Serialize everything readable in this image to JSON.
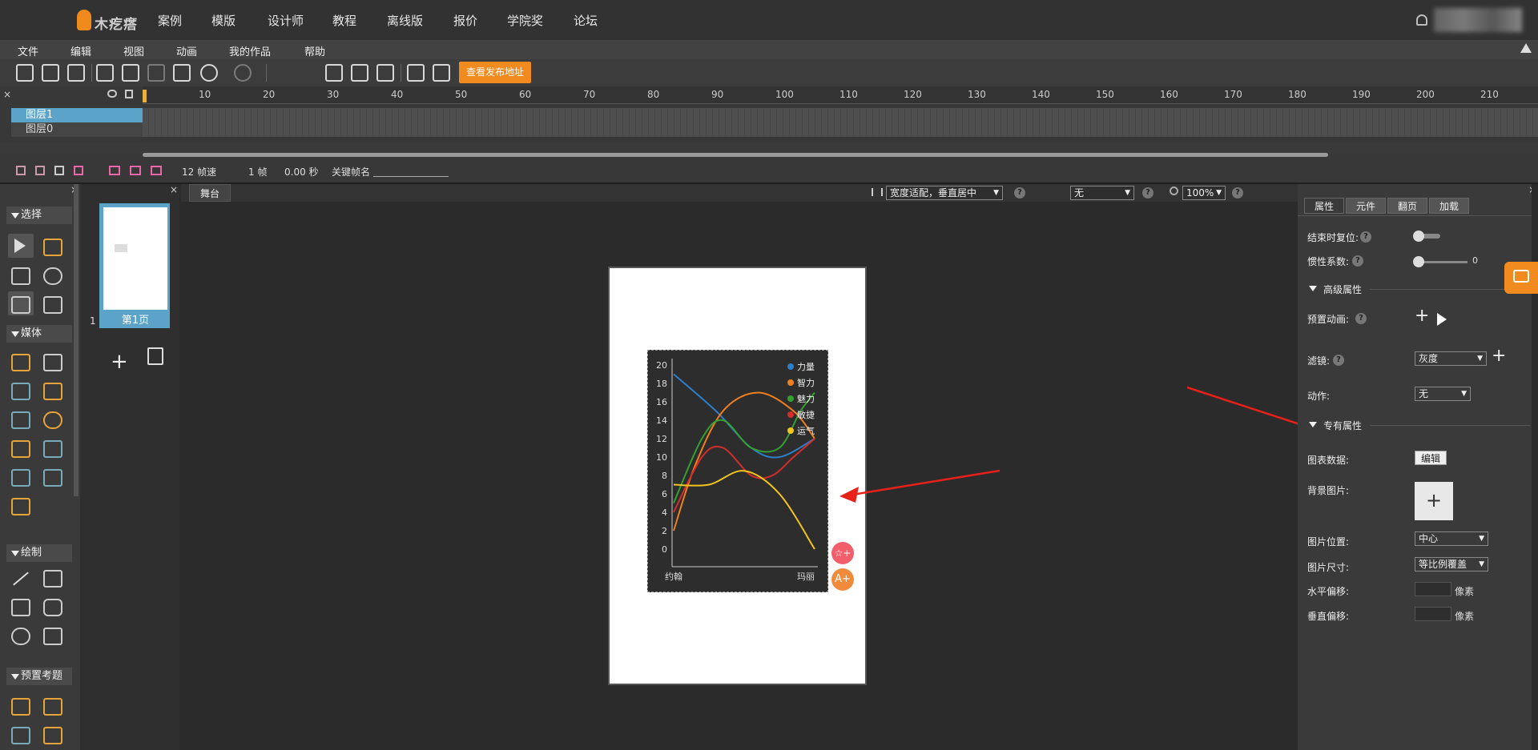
{
  "topnav": {
    "logo_text": "木疙瘩",
    "items": [
      "案例",
      "模版",
      "设计师",
      "教程",
      "离线版",
      "报价",
      "学院奖",
      "论坛"
    ]
  },
  "menubar": {
    "items": [
      "文件",
      "编辑",
      "视图",
      "动画",
      "我的作品",
      "帮助"
    ]
  },
  "toolbar": {
    "publish_label": "查看发布地址"
  },
  "timeline": {
    "ticks": [
      "10",
      "20",
      "30",
      "40",
      "50",
      "60",
      "70",
      "80",
      "90",
      "100",
      "110",
      "120",
      "130",
      "140",
      "150",
      "160",
      "170",
      "180",
      "190",
      "200",
      "210"
    ],
    "layers": [
      "图层1",
      "图层0"
    ],
    "fps": "12 帧速",
    "frame": "1 帧",
    "time": "0.00 秒",
    "keyframe_label": "关键帧名"
  },
  "leftpanel": {
    "sections": [
      "选择",
      "媒体",
      "绘制",
      "预置考题"
    ]
  },
  "pages": {
    "number": "1",
    "label": "第1页"
  },
  "stage": {
    "tab": "舞台",
    "fit_mode": "宽度适配，垂直居中",
    "bg_select": "无",
    "zoom": "100%"
  },
  "canvas": {
    "fab1": "☆+",
    "fab2": "A+"
  },
  "rightpanel": {
    "tabs": [
      "属性",
      "元件",
      "翻页",
      "加载"
    ],
    "reset_label": "结束时复位:",
    "inertia_label": "惯性系数:",
    "inertia_value": "0",
    "advanced_section": "高级属性",
    "preset_anim_label": "预置动画:",
    "filter_label": "滤镜:",
    "filter_value": "灰度",
    "action_label": "动作:",
    "action_value": "无",
    "private_section": "专有属性",
    "chart_data_label": "图表数据:",
    "edit_button": "编辑",
    "bg_image_label": "背景图片:",
    "img_pos_label": "图片位置:",
    "img_pos_value": "中心",
    "img_size_label": "图片尺寸:",
    "img_size_value": "等比例覆盖",
    "h_offset_label": "水平偏移:",
    "v_offset_label": "垂直偏移:",
    "px_unit": "像素"
  },
  "colors": {
    "accent": "#f18b1f",
    "arrow": "#e8201a",
    "thumb_blue": "#5ba3c9"
  },
  "chart_data": {
    "type": "line",
    "categories": [
      "约翰",
      "玛丽"
    ],
    "ylim": [
      0,
      20
    ],
    "yticks": [
      "0",
      "2",
      "4",
      "6",
      "8",
      "10",
      "12",
      "14",
      "16",
      "18",
      "20"
    ],
    "legend_position": "top-right",
    "series": [
      {
        "name": "力量",
        "color": "#2e7fc9",
        "points": [
          [
            0,
            19
          ],
          [
            0.3,
            15
          ],
          [
            0.55,
            11
          ],
          [
            0.75,
            10
          ],
          [
            1,
            12
          ]
        ]
      },
      {
        "name": "智力",
        "color": "#f07f1f",
        "points": [
          [
            0,
            2
          ],
          [
            0.15,
            9
          ],
          [
            0.35,
            15
          ],
          [
            0.6,
            17
          ],
          [
            0.85,
            15
          ],
          [
            1,
            12
          ]
        ]
      },
      {
        "name": "魅力",
        "color": "#35a032",
        "points": [
          [
            0,
            5
          ],
          [
            0.2,
            12
          ],
          [
            0.35,
            14
          ],
          [
            0.55,
            11
          ],
          [
            0.75,
            11
          ],
          [
            0.9,
            15
          ],
          [
            1,
            17
          ]
        ]
      },
      {
        "name": "敏捷",
        "color": "#d42d2d",
        "points": [
          [
            0,
            4
          ],
          [
            0.2,
            10
          ],
          [
            0.35,
            11
          ],
          [
            0.55,
            8
          ],
          [
            0.7,
            8
          ],
          [
            0.85,
            10
          ],
          [
            1,
            12
          ]
        ]
      },
      {
        "name": "运气",
        "color": "#f2c51d",
        "points": [
          [
            0,
            7
          ],
          [
            0.25,
            7
          ],
          [
            0.5,
            8.5
          ],
          [
            0.75,
            6
          ],
          [
            1,
            0
          ]
        ]
      }
    ]
  }
}
